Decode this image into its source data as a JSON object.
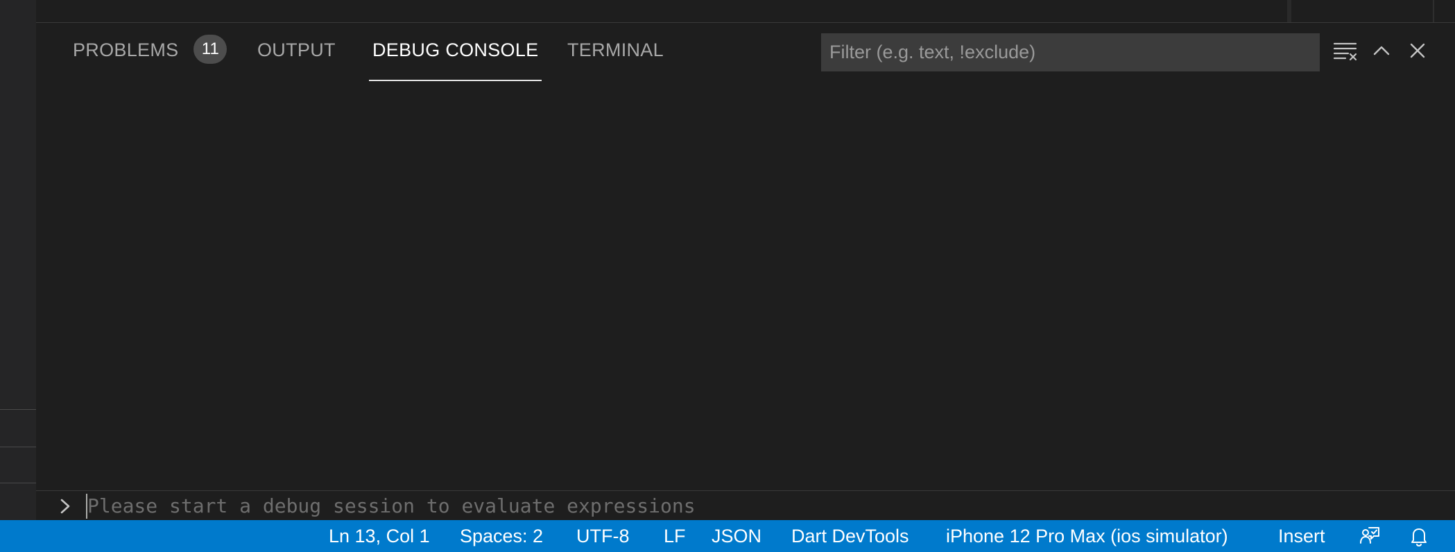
{
  "panel": {
    "tabs": [
      {
        "label": "PROBLEMS",
        "badge": "11"
      },
      {
        "label": "OUTPUT"
      },
      {
        "label": "DEBUG CONSOLE",
        "active": true
      },
      {
        "label": "TERMINAL"
      }
    ],
    "filter": {
      "placeholder": "Filter (e.g. text, !exclude)",
      "value": ""
    },
    "actions": [
      "clear-console-icon",
      "maximize-panel-icon",
      "close-panel-icon"
    ]
  },
  "console": {
    "input_placeholder": "Please start a debug session to evaluate expressions"
  },
  "status_bar": {
    "background": "#007acc",
    "position": "Ln 13, Col 1",
    "indentation": "Spaces: 2",
    "encoding": "UTF-8",
    "eol": "LF",
    "language": "JSON",
    "devtools": "Dart DevTools",
    "device": "iPhone 12 Pro Max (ios simulator)",
    "mode": "Insert",
    "icons": [
      "feedback-icon",
      "notifications-bell-icon"
    ]
  }
}
